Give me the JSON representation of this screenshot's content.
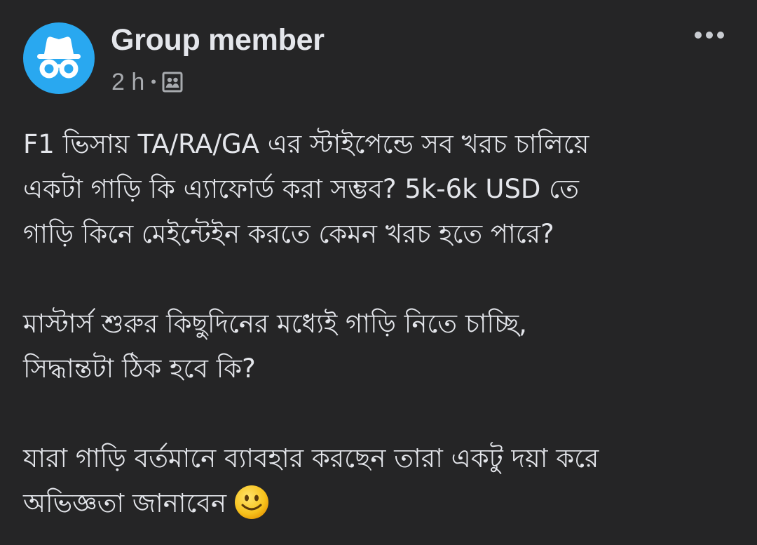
{
  "post": {
    "author": "Group member",
    "avatar_icon": "anonymous-incognito-icon",
    "avatar_color": "#29a8f0",
    "timestamp": "2 h",
    "separator": "•",
    "audience_icon": "group-audience-icon",
    "more_icon": "more-options-icon",
    "paragraphs": [
      {
        "lines": [
          "F1 ভিসায় TA/RA/GA এর স্টাইপেন্ডে সব খরচ চালিয়ে",
          "একটা গাড়ি কি এ্যাফোর্ড করা সম্ভব? 5k-6k USD তে",
          "গাড়ি কিনে মেইন্টেইন করতে কেমন খরচ হতে পারে?"
        ]
      },
      {
        "lines": [
          "মাস্টার্স শুরুর কিছুদিনের মধ্যেই গাড়ি নিতে চাচ্ছি,",
          "সিদ্ধান্তটা ঠিক হবে কি?"
        ]
      },
      {
        "lines": [
          "যারা গাড়ি বর্তমানে ব্যাবহার করছেন তারা একটু দয়া করে",
          "অভিজ্ঞতা জানাবেন"
        ],
        "trailing_emoji": "smiling-face-emoji"
      }
    ]
  },
  "colors": {
    "background": "#252526",
    "text_primary": "#e4e6eb",
    "text_secondary": "#a8abaf",
    "accent": "#29a8f0"
  }
}
